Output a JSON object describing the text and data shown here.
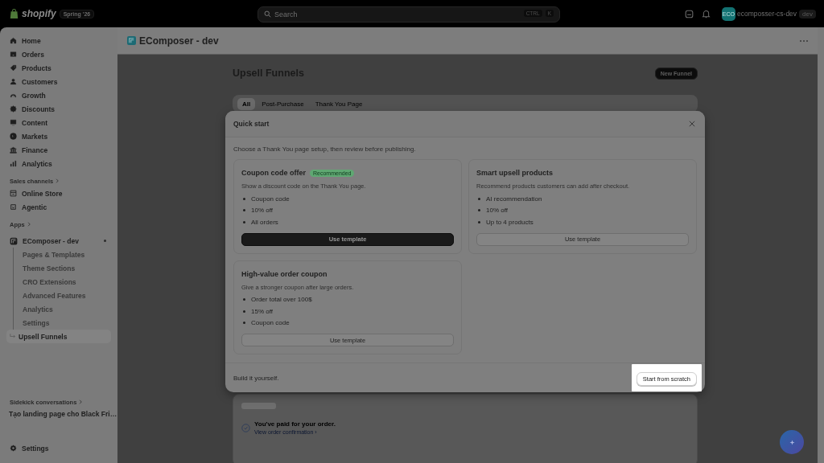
{
  "top_bar": {
    "brand": "shopify",
    "version": "Spring '26",
    "search": {
      "placeholder": "Search",
      "shortcut": [
        "CTRL",
        "K"
      ]
    },
    "store": {
      "initials": "ECO",
      "name": "ecomposser-cs-dev",
      "badge": "dev"
    }
  },
  "sidebar": {
    "items": [
      {
        "label": "Home",
        "selected": false
      },
      {
        "label": "Orders",
        "selected": false
      },
      {
        "label": "Products",
        "selected": false
      },
      {
        "label": "Customers",
        "selected": false
      },
      {
        "label": "Growth",
        "selected": false
      },
      {
        "label": "Discounts",
        "selected": false
      },
      {
        "label": "Content",
        "selected": false
      },
      {
        "label": "Markets",
        "selected": false
      },
      {
        "label": "Finance",
        "selected": false
      },
      {
        "label": "Analytics",
        "selected": false
      }
    ],
    "sales_channels": {
      "heading": "Sales channels",
      "items": [
        {
          "label": "Online Store",
          "selected": false
        },
        {
          "label": "Agentic",
          "selected": false
        }
      ]
    },
    "apps": {
      "heading": "Apps",
      "app": {
        "label": "EComposer - dev",
        "expanded": true,
        "children": [
          {
            "label": "Pages & Templates",
            "selected": false
          },
          {
            "label": "Theme Sections",
            "selected": false
          },
          {
            "label": "CRO Extensions",
            "selected": false
          },
          {
            "label": "Advanced Features",
            "selected": false
          },
          {
            "label": "Analytics",
            "selected": false
          },
          {
            "label": "Settings",
            "selected": false
          },
          {
            "label": "Upsell Funnels",
            "selected": true
          }
        ]
      }
    },
    "sidekick": {
      "heading": "Sidekick conversations",
      "items": [
        "Tạo landing page cho Black Fri…"
      ]
    },
    "settings": "Settings"
  },
  "app_header": {
    "title": "EComposer - dev"
  },
  "page": {
    "title": "Upsell Funnels",
    "primary_action": "New Funnel",
    "tabs": [
      {
        "label": "All",
        "selected": true
      },
      {
        "label": "Post-Purchase",
        "selected": false
      },
      {
        "label": "Thank You Page",
        "selected": false
      }
    ],
    "preview": {
      "message": "You've paid for your order.",
      "link": "View order confirmation ›"
    }
  },
  "modal": {
    "title": "Quick start",
    "intro": "Choose a Thank You page setup, then review before publishing.",
    "templates": [
      {
        "title": "Coupon code offer",
        "badge": "Recommended",
        "description": "Show a discount code on the Thank You page.",
        "bullets": [
          "Coupon code",
          "10% off",
          "All orders"
        ],
        "button": "Use template",
        "primary": true
      },
      {
        "title": "Smart upsell products",
        "description": "Recommend products customers can add after checkout.",
        "bullets": [
          "AI recommendation",
          "10% off",
          "Up to 4 products"
        ],
        "button": "Use template",
        "primary": false
      },
      {
        "title": "High-value order coupon",
        "description": "Give a stronger coupon after large orders.",
        "bullets": [
          "Order total over 100$",
          "15% off",
          "Coupon code"
        ],
        "button": "Use template",
        "primary": false
      }
    ],
    "footer_text": "Build it yourself.",
    "footer_button": {
      "label": "Start from scratch",
      "highlighted": true
    }
  }
}
